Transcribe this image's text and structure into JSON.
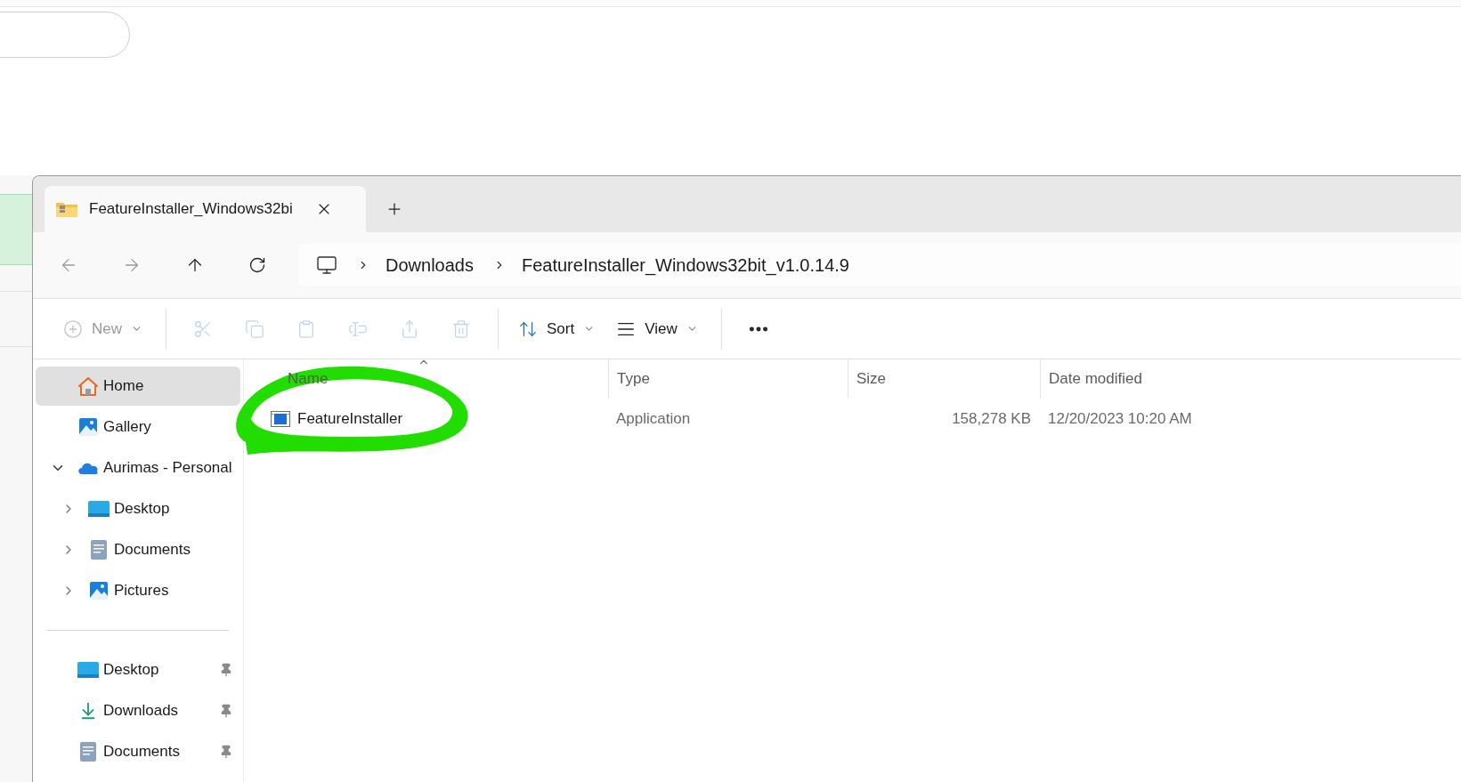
{
  "tab": {
    "title": "FeatureInstaller_Windows32bi",
    "selected": true
  },
  "address": {
    "segments": [
      "Downloads",
      "FeatureInstaller_Windows32bit_v1.0.14.9"
    ]
  },
  "toolbar": [
    {
      "kind": "new",
      "label": "New",
      "disabled": true
    },
    {
      "kind": "cut",
      "disabled": true
    },
    {
      "kind": "copy",
      "disabled": true
    },
    {
      "kind": "paste",
      "disabled": true
    },
    {
      "kind": "rename",
      "disabled": true
    },
    {
      "kind": "share",
      "disabled": true
    },
    {
      "kind": "delete",
      "disabled": true
    },
    {
      "kind": "sort",
      "label": "Sort",
      "disabled": false
    },
    {
      "kind": "view",
      "label": "View",
      "disabled": false
    },
    {
      "kind": "more",
      "disabled": false
    }
  ],
  "sidebar": {
    "items": [
      {
        "kind": "home",
        "label": "Home",
        "selected": true
      },
      {
        "kind": "gallery",
        "label": "Gallery",
        "selected": false
      },
      {
        "kind": "cloud",
        "label": "Aurimas - Personal",
        "selected": false,
        "expanded": true,
        "children": [
          {
            "kind": "desktop",
            "label": "Desktop",
            "selected": false,
            "expanded": false
          },
          {
            "kind": "documents",
            "label": "Documents",
            "selected": false,
            "expanded": false
          },
          {
            "kind": "pictures",
            "label": "Pictures",
            "selected": false,
            "expanded": false
          }
        ]
      }
    ],
    "pinned": [
      {
        "kind": "desktop",
        "label": "Desktop",
        "selected": false,
        "pinned": true
      },
      {
        "kind": "downloads",
        "label": "Downloads",
        "selected": false,
        "pinned": true
      },
      {
        "kind": "documents",
        "label": "Documents",
        "selected": false,
        "pinned": true
      }
    ]
  },
  "table": {
    "columns": [
      {
        "label": "Name",
        "sorted": true
      },
      {
        "label": "Type",
        "sorted": false
      },
      {
        "label": "Size",
        "sorted": false
      },
      {
        "label": "Date modified",
        "sorted": false
      }
    ],
    "rows": [
      {
        "name": "FeatureInstaller",
        "type": "Application",
        "size": "158,278 KB",
        "date": "12/20/2023 10:20 AM"
      }
    ]
  }
}
